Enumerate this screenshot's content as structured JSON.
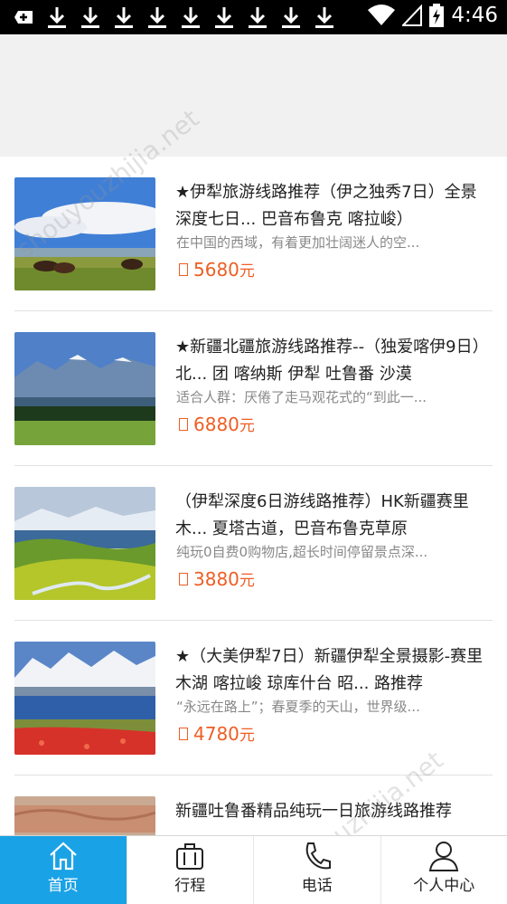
{
  "status_bar": {
    "time": "4:46"
  },
  "items": [
    {
      "title": "★伊犁旅游线路推荐（伊之独秀7日）全景深度七日... 巴音布鲁克 喀拉峻）",
      "desc": "在中国的西域，有着更加壮阔迷人的空...",
      "price": "5680",
      "unit": "元"
    },
    {
      "title": "★新疆北疆旅游线路推荐--（独爱喀伊9日）北... 团 喀纳斯 伊犁 吐鲁番 沙漠",
      "desc": "适合人群：厌倦了走马观花式的“到此一...",
      "price": "6880",
      "unit": "元"
    },
    {
      "title": "（伊犁深度6日游线路推荐）HK新疆赛里木... 夏塔古道，巴音布鲁克草原",
      "desc": "纯玩0自费0购物店,超长时间停留景点深...",
      "price": "3880",
      "unit": "元"
    },
    {
      "title": "★（大美伊犁7日）新疆伊犁全景摄影-赛里木湖 喀拉峻 琼库什台 昭... 路推荐",
      "desc": "“永远在路上”；春夏季的天山，世界级...",
      "price": "4780",
      "unit": "元"
    },
    {
      "title": "新疆吐鲁番精品纯玩一日旅游线路推荐",
      "desc": "",
      "price": "",
      "unit": ""
    }
  ],
  "tabs": [
    {
      "label": "首页",
      "icon": "home-icon",
      "active": true
    },
    {
      "label": "行程",
      "icon": "suitcase-icon",
      "active": false
    },
    {
      "label": "电话",
      "icon": "phone-icon",
      "active": false
    },
    {
      "label": "个人中心",
      "icon": "person-icon",
      "active": false
    }
  ],
  "colors": {
    "accent": "#1aa2e6",
    "price": "#ee5e24"
  }
}
